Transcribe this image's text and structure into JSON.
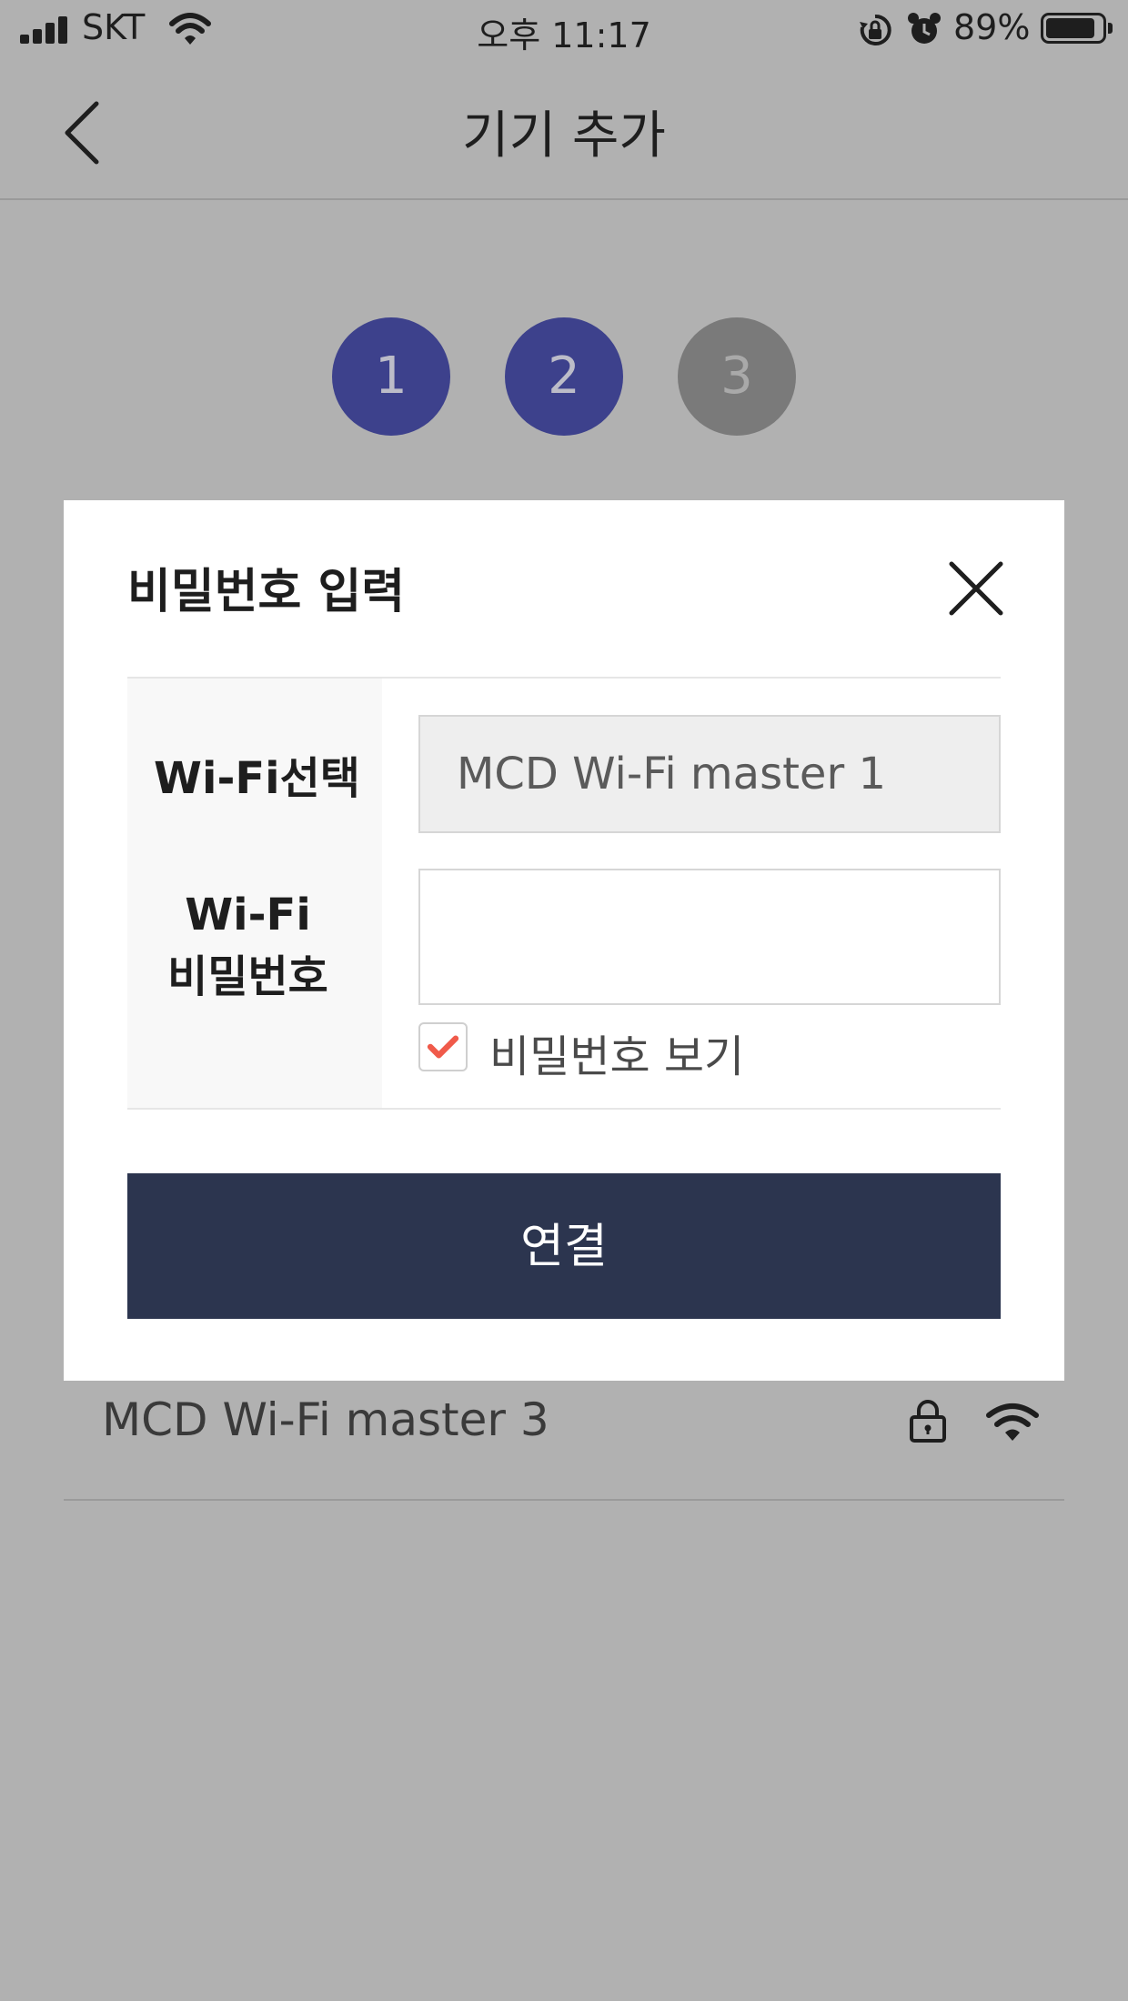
{
  "status_bar": {
    "carrier": "SKT",
    "time": "오후 11:17",
    "battery_percent": "89%",
    "battery_level": 0.89
  },
  "nav": {
    "title": "기기 추가"
  },
  "steps": [
    {
      "label": "1",
      "state": "active"
    },
    {
      "label": "2",
      "state": "active"
    },
    {
      "label": "3",
      "state": "inactive"
    }
  ],
  "background_list": {
    "items": [
      {
        "ssid": "MCD Wi-Fi master 3",
        "icons": [
          "lock-icon",
          "wifi-icon"
        ]
      }
    ]
  },
  "modal": {
    "title": "비밀번호 입력",
    "wifi_select_label": "Wi-Fi선택",
    "wifi_select_value": "MCD Wi-Fi master 1",
    "password_label_line1": "Wi-Fi",
    "password_label_line2": "비밀번호",
    "password_value": "",
    "show_password_label": "비밀번호 보기",
    "show_password_checked": true,
    "connect_label": "연결"
  },
  "colors": {
    "overlay": "#b1b1b1",
    "step_active": "#3d418c",
    "step_inactive": "#7a7a7a",
    "connect_button": "#2c354f",
    "checkmark": "#f05a4a"
  }
}
